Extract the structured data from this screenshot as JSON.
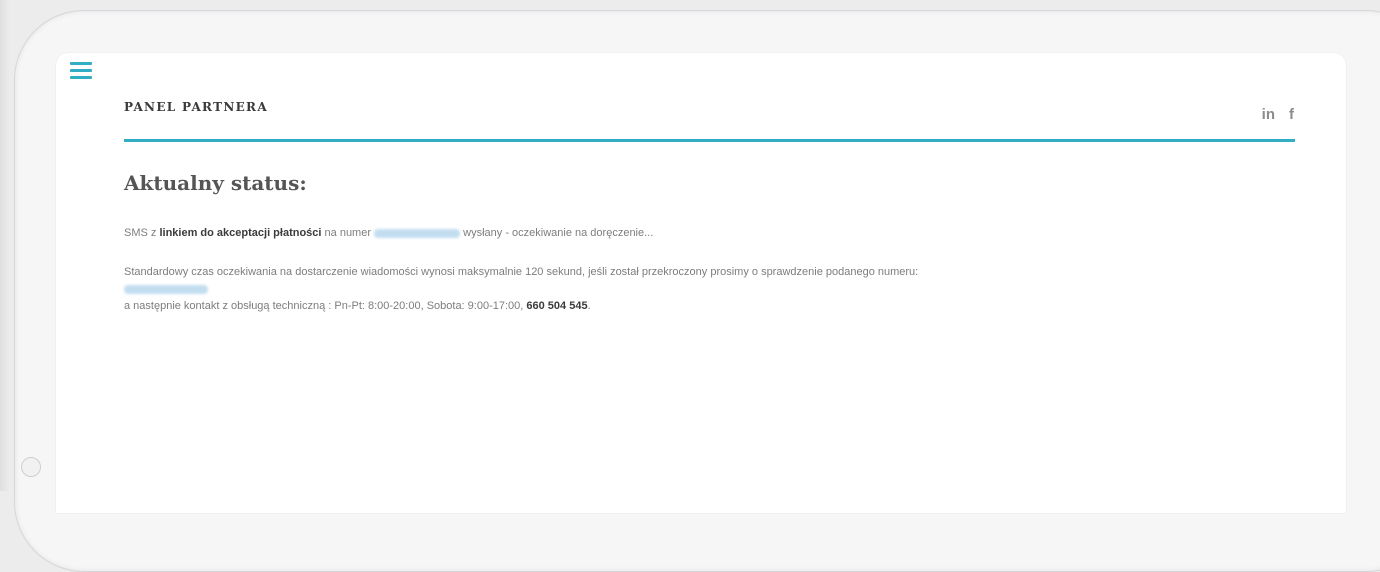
{
  "header": {
    "brand": "PANEL PARTNERA",
    "social": {
      "linkedin": "in",
      "facebook": "f"
    }
  },
  "status": {
    "title": "Aktualny status:",
    "sms_prefix": "SMS z",
    "sms_link": "linkiem do akceptacji płatności",
    "sms_number_label": "na numer",
    "sms_suffix": "wysłany - oczekiwanie na doręczenie...",
    "wait_info": "Standardowy czas oczekiwania na dostarczenie wiadomości wynosi maksymalnie 120 sekund, jeśli został przekroczony prosimy o sprawdzenie podanego numeru:",
    "contact_prefix": "a następnie kontakt z obsługą techniczną : Pn-Pt: 8:00-20:00, Sobota: 9:00-17:00,",
    "contact_phone": "660 504 545",
    "contact_suffix": "."
  },
  "colors": {
    "accent": "#31aec3",
    "text": "#7d7d7d",
    "heading": "#555555"
  },
  "icons": {
    "menu": "hamburger-menu-icon",
    "linkedin": "linkedin-icon",
    "facebook": "facebook-icon"
  }
}
